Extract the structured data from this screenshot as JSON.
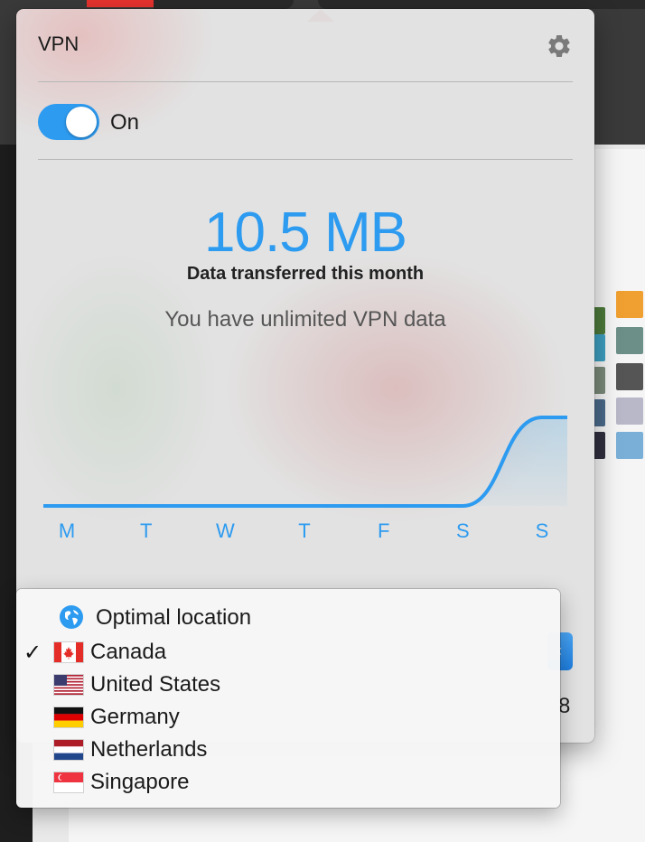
{
  "popover": {
    "title": "VPN",
    "settings_icon": "gear-icon",
    "toggle": {
      "state": "on",
      "label": "On"
    },
    "data_amount": "10.5 MB",
    "data_caption": "Data transferred this month",
    "data_note": "You have unlimited VPN data",
    "accent_color": "#2d9bf0"
  },
  "chart_data": {
    "type": "area",
    "categories": [
      "M",
      "T",
      "W",
      "T",
      "F",
      "S",
      "S"
    ],
    "values": [
      0,
      0,
      0,
      0,
      0,
      0,
      10.5
    ],
    "title": "",
    "xlabel": "",
    "ylabel": ""
  },
  "behind": {
    "partial_number": "8"
  },
  "location_menu": {
    "items": [
      {
        "label": "Optimal location",
        "icon": "globe-icon",
        "checked": false
      },
      {
        "label": "Canada",
        "icon": "flag-canada-icon",
        "checked": true
      },
      {
        "label": "United States",
        "icon": "flag-us-icon",
        "checked": false
      },
      {
        "label": "Germany",
        "icon": "flag-germany-icon",
        "checked": false
      },
      {
        "label": "Netherlands",
        "icon": "flag-netherlands-icon",
        "checked": false
      },
      {
        "label": "Singapore",
        "icon": "flag-singapore-icon",
        "checked": false
      }
    ],
    "check_glyph": "✓"
  }
}
